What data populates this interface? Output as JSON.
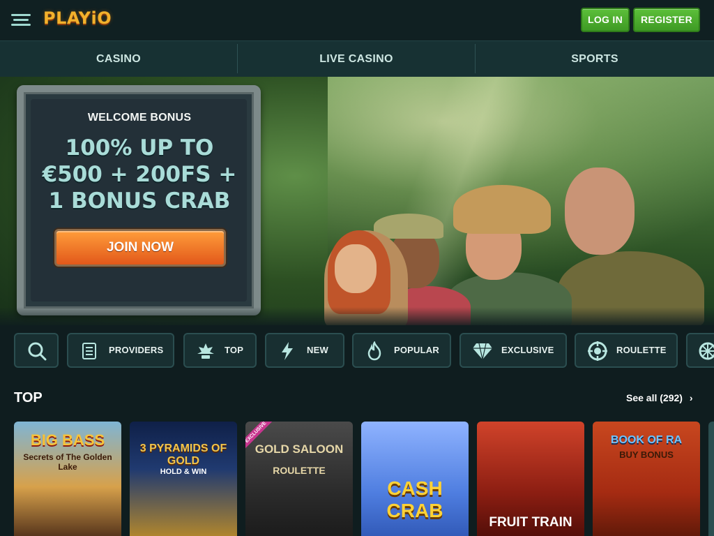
{
  "header": {
    "logo": "PLAYiO",
    "login": "LOG IN",
    "register": "REGISTER"
  },
  "nav": {
    "items": [
      "CASINO",
      "LIVE CASINO",
      "SPORTS"
    ]
  },
  "hero": {
    "welcome": "WELCOME BONUS",
    "line1": "100% UP TO",
    "line2": "€500 + 200FS +",
    "line3": "1 BONUS CRAB",
    "cta": "JOIN NOW"
  },
  "categories": [
    {
      "label": "",
      "icon": "search-icon"
    },
    {
      "label": "PROVIDERS",
      "icon": "book-icon"
    },
    {
      "label": "TOP",
      "icon": "crown-leaf-icon"
    },
    {
      "label": "NEW",
      "icon": "lightning-icon"
    },
    {
      "label": "POPULAR",
      "icon": "flame-icon"
    },
    {
      "label": "EXCLUSIVE",
      "icon": "diamond-icon"
    },
    {
      "label": "ROULETTE",
      "icon": "roulette-icon"
    }
  ],
  "section": {
    "title": "TOP",
    "see_all": "See all (292)"
  },
  "games": [
    {
      "title": "BIG BASS",
      "subtitle": "Secrets of The Golden Lake"
    },
    {
      "title": "3 PYRAMIDS OF GOLD",
      "subtitle": "HOLD & WIN"
    },
    {
      "title": "GOLD SALOON",
      "subtitle": "ROULETTE",
      "badge": "EXCLUSIVE"
    },
    {
      "title": "CASH CRAB",
      "subtitle": ""
    },
    {
      "title": "FRUIT TRAIN",
      "subtitle": ""
    },
    {
      "title": "BOOK OF RA",
      "subtitle": "BUY BONUS"
    }
  ],
  "colors": {
    "accent_green": "#4caf2e",
    "accent_orange": "#f07a28",
    "bg": "#0f1d1f"
  }
}
